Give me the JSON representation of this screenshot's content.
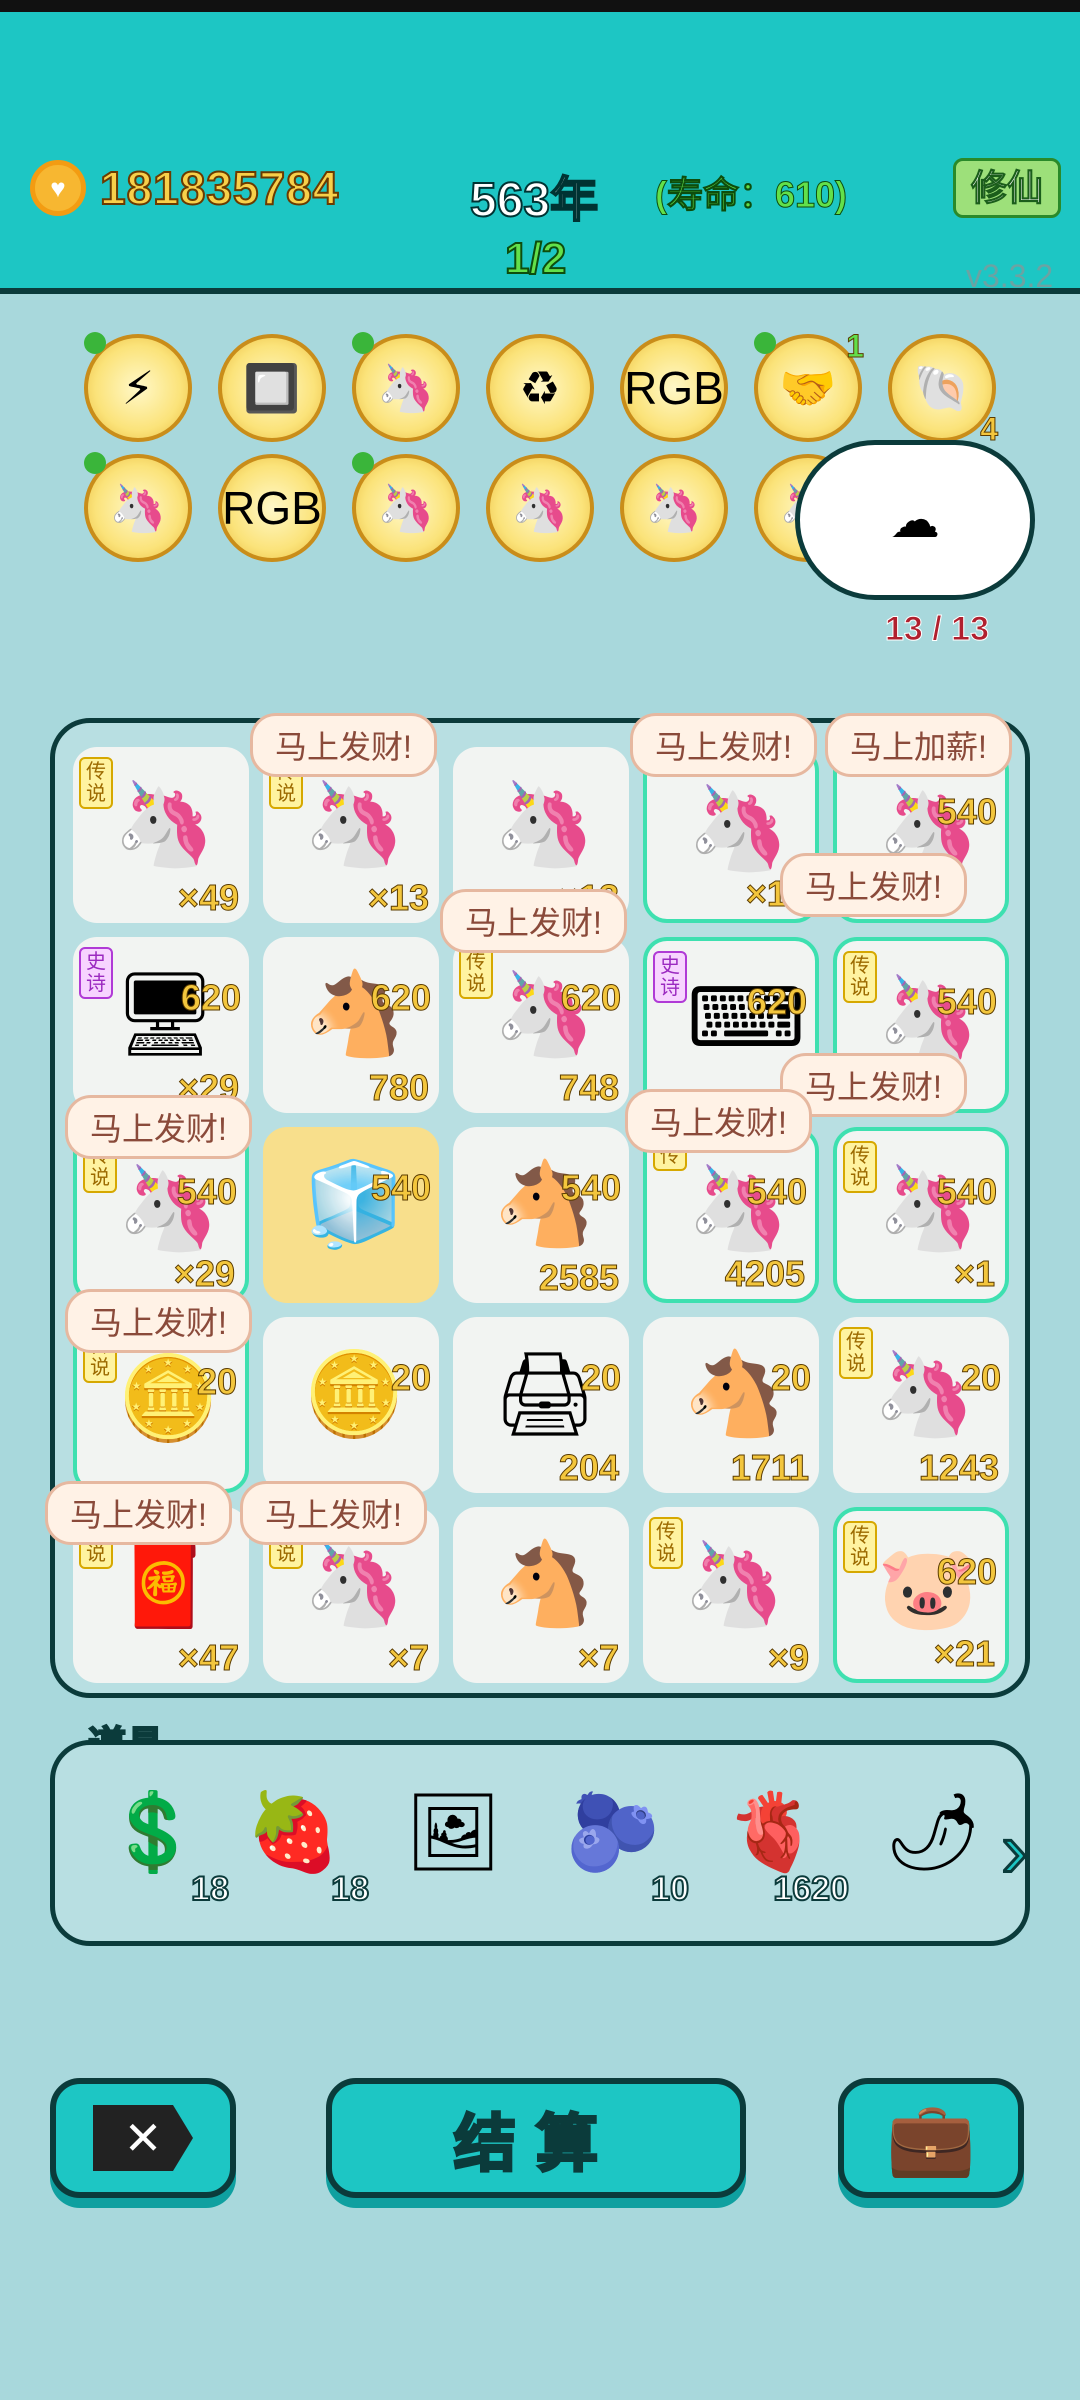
{
  "header": {
    "coins": "181835784",
    "year": "563年",
    "lifespan": "(寿命：610)",
    "xiuxian_button": "修仙",
    "page": "1/2",
    "version": "v3.3.2"
  },
  "relics": {
    "row1": [
      {
        "name": "lightning-relic",
        "icon": "⚡",
        "pinned": true
      },
      {
        "name": "cpu-chip-relic",
        "icon": "🔲",
        "pinned": false
      },
      {
        "name": "unicorn-relic",
        "icon": "🦄",
        "pinned": true
      },
      {
        "name": "recycle-relic",
        "icon": "♻",
        "pinned": false
      },
      {
        "name": "rgb-relic",
        "icon": "RGB",
        "pinned": false
      },
      {
        "name": "handshake-relic",
        "icon": "🤝",
        "pinned": true,
        "badge": "1"
      },
      {
        "name": "shell-relic",
        "icon": "🐚",
        "pinned": false,
        "badge": "4"
      }
    ],
    "row2": [
      {
        "name": "unicorn-relic",
        "icon": "🦄",
        "pinned": true
      },
      {
        "name": "rgb-relic",
        "icon": "RGB",
        "pinned": false
      },
      {
        "name": "unicorn-relic",
        "icon": "🦄",
        "pinned": true
      },
      {
        "name": "unicorn-relic",
        "icon": "🦄",
        "pinned": false
      },
      {
        "name": "unicorn-relic",
        "icon": "🦄",
        "pinned": false
      },
      {
        "name": "unicorn-relic",
        "icon": "🦄",
        "pinned": false
      }
    ]
  },
  "cloud": {
    "counter": "13 / 13"
  },
  "board": {
    "cells": [
      {
        "r": 0,
        "c": 0,
        "icon": "🦄",
        "rarity": "传说",
        "value": "×49",
        "bonus": ""
      },
      {
        "r": 0,
        "c": 1,
        "icon": "🦄",
        "rarity": "传说",
        "value": "×13",
        "bonus": ""
      },
      {
        "r": 0,
        "c": 2,
        "icon": "🦄",
        "rarity": "",
        "value": "×13",
        "bonus": ""
      },
      {
        "r": 0,
        "c": 3,
        "icon": "🦄",
        "rarity": "",
        "value": "×11",
        "bonus": "",
        "glow": true
      },
      {
        "r": 0,
        "c": 4,
        "icon": "🦄",
        "rarity": "",
        "value": "",
        "bonus": "540",
        "glow": true
      },
      {
        "r": 1,
        "c": 0,
        "icon": "🖥",
        "rarity": "史诗",
        "epic": true,
        "value": "×29",
        "bonus": "620"
      },
      {
        "r": 1,
        "c": 1,
        "icon": "🐴",
        "rarity": "",
        "value": "780",
        "bonus": "620"
      },
      {
        "r": 1,
        "c": 2,
        "icon": "🦄",
        "rarity": "传说",
        "value": "748",
        "bonus": "620"
      },
      {
        "r": 1,
        "c": 3,
        "icon": "⌨",
        "rarity": "史诗",
        "epic": true,
        "value": "",
        "bonus": "620",
        "glow": true
      },
      {
        "r": 1,
        "c": 4,
        "icon": "🦄",
        "rarity": "传说",
        "value": "",
        "bonus": "540",
        "glow": true
      },
      {
        "r": 2,
        "c": 0,
        "icon": "🦄",
        "rarity": "传说",
        "value": "×29",
        "bonus": "540",
        "glow": true
      },
      {
        "r": 2,
        "c": 1,
        "icon": "🧊",
        "rarity": "",
        "value": "",
        "bonus": "540",
        "gold": true
      },
      {
        "r": 2,
        "c": 2,
        "icon": "🐴",
        "rarity": "",
        "value": "2585",
        "bonus": "540"
      },
      {
        "r": 2,
        "c": 3,
        "icon": "🦄",
        "rarity": "传",
        "value": "4205",
        "bonus": "540",
        "glow": true
      },
      {
        "r": 2,
        "c": 4,
        "icon": "🦄",
        "rarity": "传说",
        "value": "×1",
        "bonus": "540",
        "glow": true
      },
      {
        "r": 3,
        "c": 0,
        "icon": "🪙",
        "rarity": "传说",
        "value": "",
        "bonus": "20",
        "glow": true
      },
      {
        "r": 3,
        "c": 1,
        "icon": "🪙",
        "rarity": "",
        "value": "",
        "bonus": "20"
      },
      {
        "r": 3,
        "c": 2,
        "icon": "🖨",
        "rarity": "",
        "value": "204",
        "bonus": "20"
      },
      {
        "r": 3,
        "c": 3,
        "icon": "🐴",
        "rarity": "",
        "value": "1711",
        "bonus": "20"
      },
      {
        "r": 3,
        "c": 4,
        "icon": "🦄",
        "rarity": "传说",
        "value": "1243",
        "bonus": "20"
      },
      {
        "r": 4,
        "c": 0,
        "icon": "🧧",
        "rarity": "传说",
        "value": "×47",
        "bonus": ""
      },
      {
        "r": 4,
        "c": 1,
        "icon": "🦄",
        "rarity": "传说",
        "value": "×7",
        "bonus": ""
      },
      {
        "r": 4,
        "c": 2,
        "icon": "🐴",
        "rarity": "",
        "value": "×7",
        "bonus": ""
      },
      {
        "r": 4,
        "c": 3,
        "icon": "🦄",
        "rarity": "传说",
        "value": "×9",
        "bonus": ""
      },
      {
        "r": 4,
        "c": 4,
        "icon": "🐷",
        "rarity": "传说",
        "value": "×21",
        "bonus": "620",
        "glow": true
      }
    ],
    "bubbles": [
      {
        "text": "马上发财!",
        "slot": "b1"
      },
      {
        "text": "马上发财!",
        "slot": "b2"
      },
      {
        "text": "马上加薪!",
        "slot": "b3"
      },
      {
        "text": "马上发财!",
        "slot": "b4"
      },
      {
        "text": "马上发财!",
        "slot": "b5"
      },
      {
        "text": "马上发财!",
        "slot": "b6"
      },
      {
        "text": "马上发财!",
        "slot": "b7"
      },
      {
        "text": "马上发财!",
        "slot": "b8"
      },
      {
        "text": "马上发财!",
        "slot": "b9"
      },
      {
        "text": "马上发财!",
        "slot": "b10"
      },
      {
        "text": "马上发财!",
        "slot": "b11"
      }
    ]
  },
  "items": {
    "label": "道具",
    "list": [
      {
        "name": "dollar-coin-item",
        "icon": "💲",
        "count": "18"
      },
      {
        "name": "strawberry-item",
        "icon": "🍓",
        "count": "18"
      },
      {
        "name": "frame-item",
        "icon": "🖼",
        "count": ""
      },
      {
        "name": "blueberry-item",
        "icon": "🫐",
        "count": "10"
      },
      {
        "name": "liver-item",
        "icon": "🫀",
        "count": "1620"
      },
      {
        "name": "pepper-item",
        "icon": "🌶",
        "count": ""
      }
    ]
  },
  "buttons": {
    "exit_icon": "✕",
    "settle": "结算",
    "bag_icon": "💼"
  },
  "colors": {
    "topbar": "#1dc6c4",
    "background": "#a8d8dc",
    "gold": "#f3c63d",
    "green": "#62e04b"
  }
}
